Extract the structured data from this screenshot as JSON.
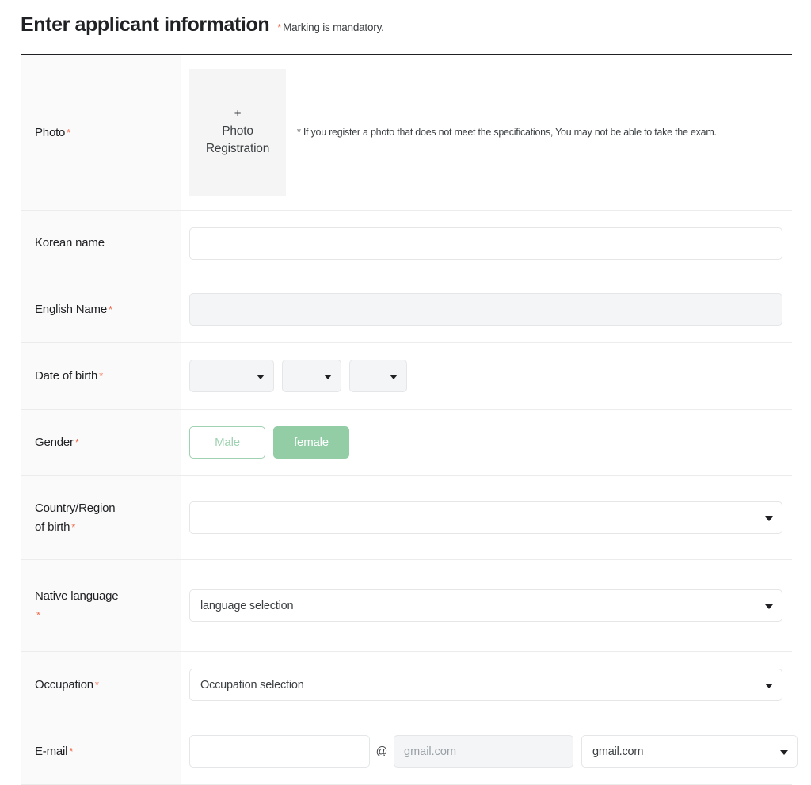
{
  "header": {
    "title": "Enter applicant information",
    "star": "*",
    "mandatory_note": "Marking is mandatory."
  },
  "colors": {
    "required_star": "#ef6b4b",
    "accent_green": "#92cda6",
    "accent_green_outline": "#9fd2b1",
    "table_top_border": "#202124",
    "row_divider": "#ececec",
    "label_bg": "#fafafa",
    "disabled_bg": "#f4f5f6"
  },
  "rows": {
    "photo": {
      "label": "Photo",
      "star": "*",
      "upload_plus": "+",
      "upload_line1": "Photo",
      "upload_line2": "Registration",
      "note": "* If you register a photo that does not meet the specifications, You may not be able to take the exam."
    },
    "korean_name": {
      "label": "Korean name",
      "star": "",
      "value": "",
      "placeholder": ""
    },
    "english_name": {
      "label": "English Name",
      "star": "*",
      "value": "",
      "placeholder": "",
      "disabled": true
    },
    "date_of_birth": {
      "label": "Date of birth",
      "star": "*",
      "year": "",
      "month": "",
      "day": "",
      "caret_icon": "chevron-down-icon"
    },
    "gender": {
      "label": "Gender",
      "star": "*",
      "options": [
        "Male",
        "female"
      ],
      "selected": "female"
    },
    "country_of_birth": {
      "label_line1": "Country/Region",
      "label_line2": "of birth",
      "star": "*",
      "value": "",
      "caret_icon": "chevron-down-icon"
    },
    "native_language": {
      "label": "Native language",
      "star": "*",
      "value": "language selection",
      "caret_icon": "chevron-down-icon"
    },
    "occupation": {
      "label": "Occupation",
      "star": "*",
      "value": "Occupation selection",
      "caret_icon": "chevron-down-icon"
    },
    "email": {
      "label": "E-mail",
      "star": "*",
      "local_value": "",
      "at_symbol": "@",
      "domain_value": "gmail.com",
      "domain_select_value": "gmail.com",
      "caret_icon": "chevron-down-icon"
    }
  }
}
